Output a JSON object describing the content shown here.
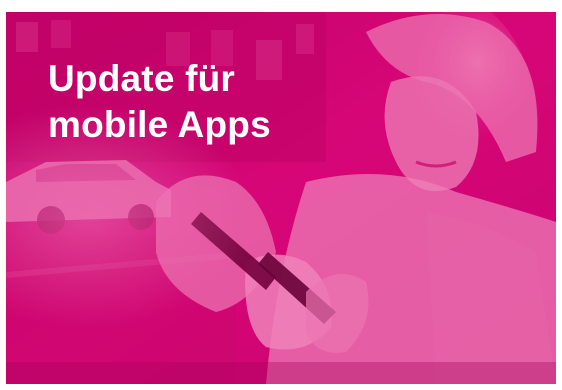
{
  "banner": {
    "headline_line1": "Update für",
    "headline_line2": "mobile Apps",
    "image_subject": "person-using-smartphone-street-photo",
    "colors": {
      "magenta_overlay": "#e20074",
      "text": "#ffffff"
    }
  }
}
